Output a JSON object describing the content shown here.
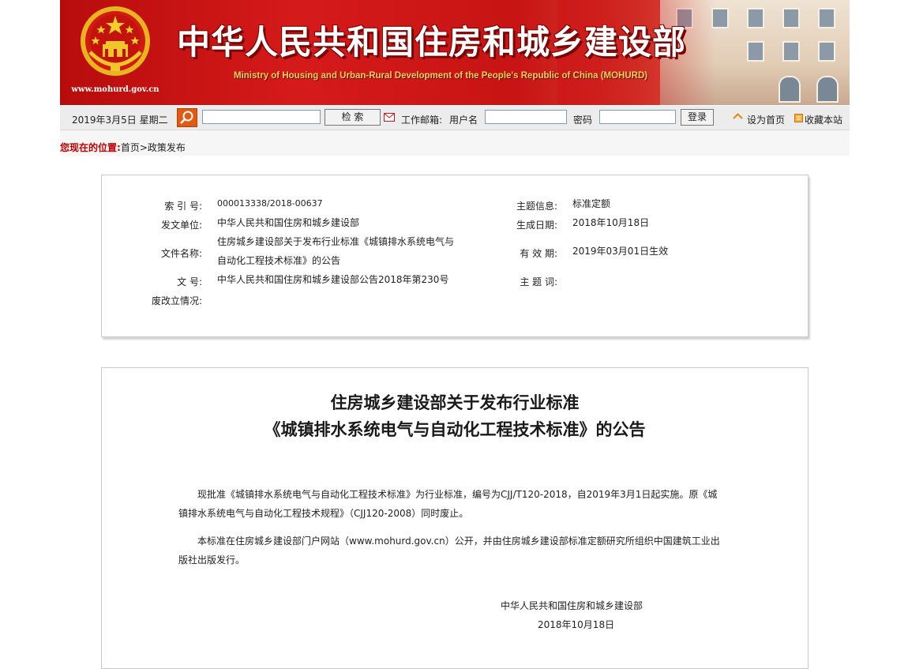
{
  "banner": {
    "title": "中华人民共和国住房和城乡建设部",
    "subtitle_en": "Ministry of Housing and Urban-Rural Development of the People's Republic of China (MOHURD)",
    "url": "www.mohurd.gov.cn"
  },
  "toolbar": {
    "date": "2019年3月5日  星期二",
    "search_placeholder": "",
    "search_button": "检  索",
    "mail_label": "工作邮箱:",
    "username_label": "用户名",
    "password_label": "密码",
    "login_button": "登录",
    "set_home": "设为首页",
    "bookmark": "收藏本站"
  },
  "breadcrumb": {
    "label": "您现在的位置:",
    "items": [
      "首页",
      "政策发布"
    ],
    "separator": ">"
  },
  "info": {
    "index_label": "索 引 号:",
    "index_value": "000013338/2018-00637",
    "issuer_label": "发文单位:",
    "issuer_value": "中华人民共和国住房和城乡建设部",
    "doc_name_label": "文件名称:",
    "doc_name_line1": "住房城乡建设部关于发布行业标准《城镇排水系统电气与",
    "doc_name_line2": "自动化工程技术标准》的公告",
    "doc_no_label": "文      号:",
    "doc_no_value": "中华人民共和国住房和城乡建设部公告2018年第230号",
    "status_label": "废改立情况:",
    "status_value": "",
    "topic_label": "主题信息:",
    "topic_value": "标准定额",
    "date_label": "生成日期:",
    "date_value": "2018年10月18日",
    "valid_label": "有 效 期:",
    "valid_value": "2019年03月01日生效",
    "keywords_label": "主 题 词:",
    "keywords_value": ""
  },
  "article": {
    "title_line1": "住房城乡建设部关于发布行业标准",
    "title_line2": "《城镇排水系统电气与自动化工程技术标准》的公告",
    "para1": "现批准《城镇排水系统电气与自动化工程技术标准》为行业标准，编号为CJJ/T120-2018，自2019年3月1日起实施。原《城镇排水系统电气与自动化工程技术规程》（CJJ120-2008）同时废止。",
    "para2": "本标准在住房城乡建设部门户网站（www.mohurd.gov.cn）公开，并由住房城乡建设部标准定额研究所组织中国建筑工业出版社出版发行。",
    "signer": "中华人民共和国住房和城乡建设部",
    "sign_date": "2018年10月18日"
  },
  "colors": {
    "banner_red": "#c81414",
    "breadcrumb_label": "#c00000",
    "search_button": "#e25a12"
  },
  "icons": [
    "emblem-icon",
    "search-icon",
    "mail-icon",
    "home-icon",
    "bookmark-icon"
  ]
}
